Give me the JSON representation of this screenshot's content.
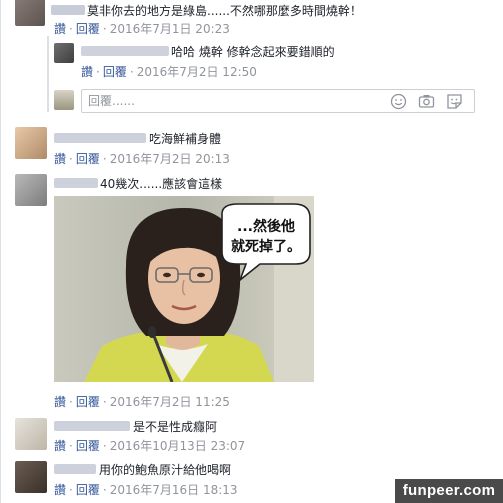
{
  "comments": [
    {
      "text": "莫非你去的地方是綠島......不然哪那麼多時間燒幹！",
      "date": "2016年7月1日 20:23"
    },
    {
      "text": "哈哈 燒幹 修幹念起來要錯順的",
      "date": "2016年7月2日 12:50"
    },
    {
      "text": "吃海鮮補身體",
      "date": "2016年7月2日 20:13"
    },
    {
      "text": "40幾次......應該會這樣",
      "photo_caption": "...然後他\n就死掉了。",
      "photo_caption_line1": "...然後他",
      "photo_caption_line2": "就死掉了。",
      "date": "2016年7月2日 11:25"
    },
    {
      "text": "是不是性成癮阿",
      "date": "2016年10月13日 23:07"
    },
    {
      "text": "用你的鮑魚原汁給他喝啊",
      "date": "2016年7月16日 18:13"
    }
  ],
  "actions": {
    "like": "讚",
    "reply": "回覆",
    "separator": "·"
  },
  "reply_box": {
    "placeholder": "回覆......"
  },
  "icons": {
    "emoji": "smile-icon",
    "camera": "camera-icon",
    "sticker": "sticker-icon"
  },
  "watermark": "funpeer.com",
  "colors": {
    "link": "#365899",
    "meta": "#90949c",
    "text": "#1d2129",
    "border": "#ccd0d5",
    "watermark_bg": "#4a4a4a"
  }
}
